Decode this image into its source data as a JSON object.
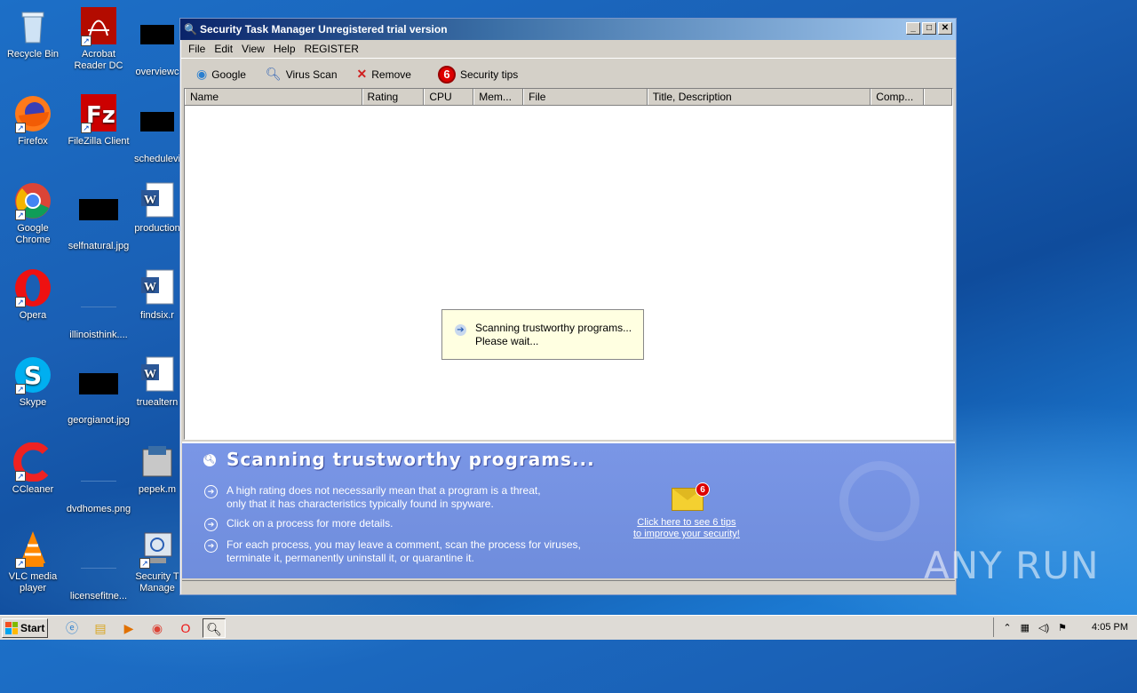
{
  "desktop": {
    "icons": [
      {
        "label": "Recycle Bin"
      },
      {
        "label": "Acrobat Reader DC"
      },
      {
        "label": "overviewc"
      },
      {
        "label": "Firefox"
      },
      {
        "label": "FileZilla Client"
      },
      {
        "label": "schedulevi"
      },
      {
        "label": "Google Chrome"
      },
      {
        "label": "selfnatural.jpg"
      },
      {
        "label": "production"
      },
      {
        "label": "Opera"
      },
      {
        "label": "illinoisthink...."
      },
      {
        "label": "findsix.r"
      },
      {
        "label": "Skype"
      },
      {
        "label": "georgianot.jpg"
      },
      {
        "label": "truealtern"
      },
      {
        "label": "CCleaner"
      },
      {
        "label": "dvdhomes.png"
      },
      {
        "label": "pepek.m"
      },
      {
        "label": "VLC media player"
      },
      {
        "label": "licensefitne..."
      },
      {
        "label": "Security T Manage"
      }
    ],
    "watermark": "ANY RUN"
  },
  "window": {
    "title": "Security Task Manager Unregistered trial version",
    "menu": [
      "File",
      "Edit",
      "View",
      "Help",
      "REGISTER"
    ],
    "toolbar": {
      "google": "Google",
      "virus_scan": "Virus Scan",
      "remove": "Remove",
      "tips_count": "6",
      "security_tips": "Security tips"
    },
    "columns": [
      "Name",
      "Rating",
      "CPU",
      "Mem...",
      "File",
      "Title, Description",
      "Comp..."
    ],
    "popup": {
      "line1": "Scanning trustworthy programs...",
      "line2": "Please wait..."
    },
    "panel": {
      "title": "Scanning trustworthy programs...",
      "item1_line1": "A high rating does not necessarily mean that a program is a threat,",
      "item1_line2": "only that it has characteristics typically found in spyware.",
      "item2": "Click on a process for more details.",
      "item3_line1": "For each process, you may leave a comment, scan the process for viruses,",
      "item3_line2": "terminate it, permanently uninstall it, or quarantine it.",
      "tips_badge": "6",
      "tips_link_line1": "Click here to see 6 tips",
      "tips_link_line2": "to improve your security!"
    }
  },
  "taskbar": {
    "start": "Start",
    "clock": "4:05 PM"
  }
}
